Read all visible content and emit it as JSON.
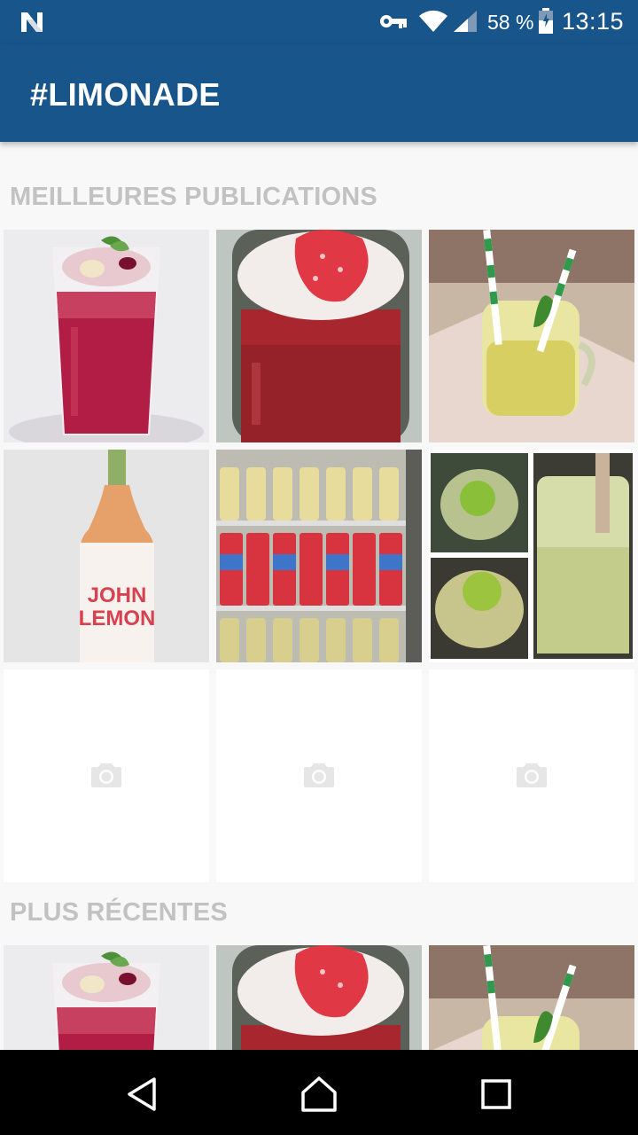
{
  "status_bar": {
    "battery_percent": "58 %",
    "time": "13:15",
    "icons": [
      "n-notification-icon",
      "vpn-key-icon",
      "wifi-icon",
      "cellular-signal-icon",
      "battery-icon"
    ]
  },
  "app_bar": {
    "title": "#LIMONADE"
  },
  "sections": {
    "top": {
      "heading": "MEILLEURES PUBLICATIONS",
      "tiles": [
        {
          "kind": "photo",
          "subject": "red berry lemonade glass with mint"
        },
        {
          "kind": "photo",
          "subject": "strawberry drink in mason jar"
        },
        {
          "kind": "photo",
          "subject": "yellow lemonade jar with green striped straws"
        },
        {
          "kind": "photo",
          "subject": "John Lemon bottle",
          "label_line1": "JOHN",
          "label_line2": "LEMON"
        },
        {
          "kind": "photo",
          "subject": "bottles and cans in fridge"
        },
        {
          "kind": "photo",
          "subject": "green herb lemonade collage"
        },
        {
          "kind": "placeholder",
          "icon": "camera-icon"
        },
        {
          "kind": "placeholder",
          "icon": "camera-icon"
        },
        {
          "kind": "placeholder",
          "icon": "camera-icon"
        }
      ]
    },
    "recent": {
      "heading": "PLUS RÉCENTES",
      "tiles": [
        {
          "kind": "photo",
          "subject": "red berry lemonade glass with mint"
        },
        {
          "kind": "photo",
          "subject": "strawberry drink in mason jar"
        },
        {
          "kind": "photo",
          "subject": "yellow lemonade jar with green striped straws"
        }
      ]
    }
  },
  "nav_bar": {
    "buttons": [
      "back-icon",
      "home-icon",
      "recents-icon"
    ]
  },
  "colors": {
    "primary": "#18558b",
    "background": "#f8f8f8",
    "section_heading": "#c2c2c2"
  }
}
